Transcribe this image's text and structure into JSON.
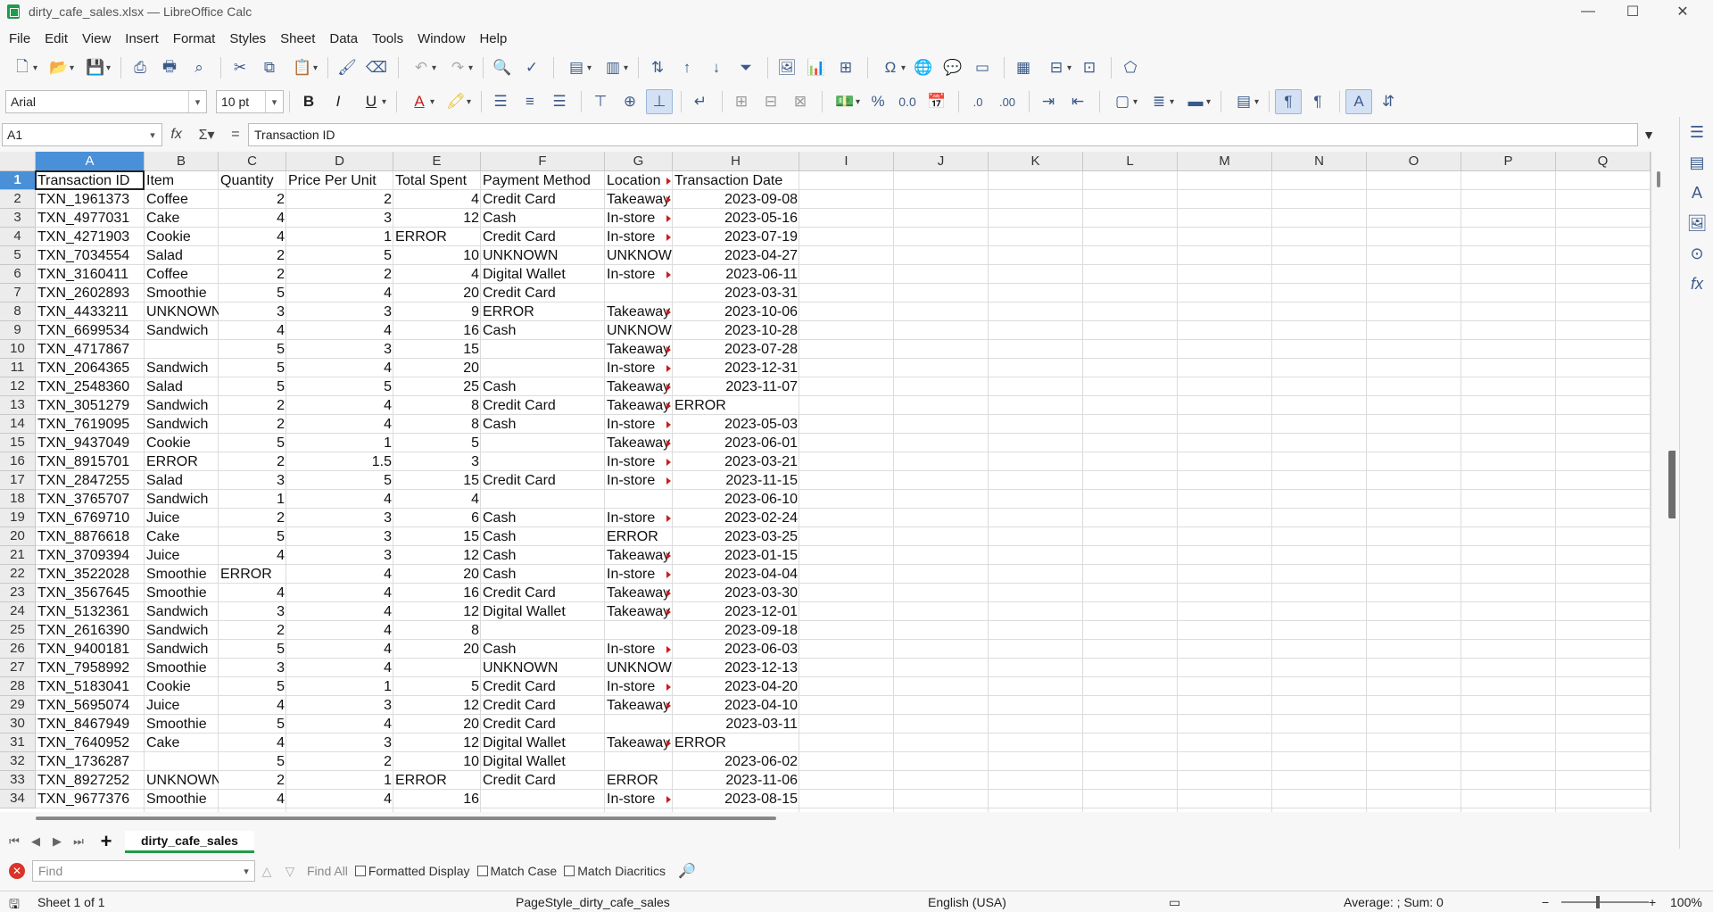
{
  "window": {
    "title": "dirty_cafe_sales.xlsx — LibreOffice Calc",
    "minimize": "—",
    "maximize": "☐",
    "close": "✕"
  },
  "menu": [
    "File",
    "Edit",
    "View",
    "Insert",
    "Format",
    "Styles",
    "Sheet",
    "Data",
    "Tools",
    "Window",
    "Help"
  ],
  "formatting": {
    "font_name": "Arial",
    "font_size": "10 pt"
  },
  "formula_bar": {
    "cell_ref": "A1",
    "content": "Transaction ID"
  },
  "columns": [
    "A",
    "B",
    "C",
    "D",
    "E",
    "F",
    "G",
    "H",
    "I",
    "J",
    "K",
    "L",
    "M",
    "N",
    "O",
    "P",
    "Q"
  ],
  "rows": [
    [
      "Transaction ID",
      "Item",
      "Quantity",
      "Price Per Unit",
      "Total Spent",
      "Payment Method",
      "Location",
      "Transaction Date"
    ],
    [
      "TXN_1961373",
      "Coffee",
      "2",
      "2",
      "4",
      "Credit Card",
      "Takeaway",
      "2023-09-08"
    ],
    [
      "TXN_4977031",
      "Cake",
      "4",
      "3",
      "12",
      "Cash",
      "In-store",
      "2023-05-16"
    ],
    [
      "TXN_4271903",
      "Cookie",
      "4",
      "1",
      "ERROR",
      "Credit Card",
      "In-store",
      "2023-07-19"
    ],
    [
      "TXN_7034554",
      "Salad",
      "2",
      "5",
      "10",
      "UNKNOWN",
      "UNKNOWN",
      "2023-04-27"
    ],
    [
      "TXN_3160411",
      "Coffee",
      "2",
      "2",
      "4",
      "Digital Wallet",
      "In-store",
      "2023-06-11"
    ],
    [
      "TXN_2602893",
      "Smoothie",
      "5",
      "4",
      "20",
      "Credit Card",
      "",
      "2023-03-31"
    ],
    [
      "TXN_4433211",
      "UNKNOWN",
      "3",
      "3",
      "9",
      "ERROR",
      "Takeaway",
      "2023-10-06"
    ],
    [
      "TXN_6699534",
      "Sandwich",
      "4",
      "4",
      "16",
      "Cash",
      "UNKNOWN",
      "2023-10-28"
    ],
    [
      "TXN_4717867",
      "",
      "5",
      "3",
      "15",
      "",
      "Takeaway",
      "2023-07-28"
    ],
    [
      "TXN_2064365",
      "Sandwich",
      "5",
      "4",
      "20",
      "",
      "In-store",
      "2023-12-31"
    ],
    [
      "TXN_2548360",
      "Salad",
      "5",
      "5",
      "25",
      "Cash",
      "Takeaway",
      "2023-11-07"
    ],
    [
      "TXN_3051279",
      "Sandwich",
      "2",
      "4",
      "8",
      "Credit Card",
      "Takeaway",
      "ERROR"
    ],
    [
      "TXN_7619095",
      "Sandwich",
      "2",
      "4",
      "8",
      "Cash",
      "In-store",
      "2023-05-03"
    ],
    [
      "TXN_9437049",
      "Cookie",
      "5",
      "1",
      "5",
      "",
      "Takeaway",
      "2023-06-01"
    ],
    [
      "TXN_8915701",
      "ERROR",
      "2",
      "1.5",
      "3",
      "",
      "In-store",
      "2023-03-21"
    ],
    [
      "TXN_2847255",
      "Salad",
      "3",
      "5",
      "15",
      "Credit Card",
      "In-store",
      "2023-11-15"
    ],
    [
      "TXN_3765707",
      "Sandwich",
      "1",
      "4",
      "4",
      "",
      "",
      "2023-06-10"
    ],
    [
      "TXN_6769710",
      "Juice",
      "2",
      "3",
      "6",
      "Cash",
      "In-store",
      "2023-02-24"
    ],
    [
      "TXN_8876618",
      "Cake",
      "5",
      "3",
      "15",
      "Cash",
      "ERROR",
      "2023-03-25"
    ],
    [
      "TXN_3709394",
      "Juice",
      "4",
      "3",
      "12",
      "Cash",
      "Takeaway",
      "2023-01-15"
    ],
    [
      "TXN_3522028",
      "Smoothie",
      "ERROR",
      "4",
      "20",
      "Cash",
      "In-store",
      "2023-04-04"
    ],
    [
      "TXN_3567645",
      "Smoothie",
      "4",
      "4",
      "16",
      "Credit Card",
      "Takeaway",
      "2023-03-30"
    ],
    [
      "TXN_5132361",
      "Sandwich",
      "3",
      "4",
      "12",
      "Digital Wallet",
      "Takeaway",
      "2023-12-01"
    ],
    [
      "TXN_2616390",
      "Sandwich",
      "2",
      "4",
      "8",
      "",
      "",
      "2023-09-18"
    ],
    [
      "TXN_9400181",
      "Sandwich",
      "5",
      "4",
      "20",
      "Cash",
      "In-store",
      "2023-06-03"
    ],
    [
      "TXN_7958992",
      "Smoothie",
      "3",
      "4",
      "",
      "UNKNOWN",
      "UNKNOWN",
      "2023-12-13"
    ],
    [
      "TXN_5183041",
      "Cookie",
      "5",
      "1",
      "5",
      "Credit Card",
      "In-store",
      "2023-04-20"
    ],
    [
      "TXN_5695074",
      "Juice",
      "4",
      "3",
      "12",
      "Credit Card",
      "Takeaway",
      "2023-04-10"
    ],
    [
      "TXN_8467949",
      "Smoothie",
      "5",
      "4",
      "20",
      "Credit Card",
      "",
      "2023-03-11"
    ],
    [
      "TXN_7640952",
      "Cake",
      "4",
      "3",
      "12",
      "Digital Wallet",
      "Takeaway",
      "ERROR"
    ],
    [
      "TXN_1736287",
      "",
      "5",
      "2",
      "10",
      "Digital Wallet",
      "",
      "2023-06-02"
    ],
    [
      "TXN_8927252",
      "UNKNOWN",
      "2",
      "1",
      "ERROR",
      "Credit Card",
      "ERROR",
      "2023-11-06"
    ],
    [
      "TXN_9677376",
      "Smoothie",
      "4",
      "4",
      "16",
      "",
      "In-store",
      "2023-08-15"
    ]
  ],
  "sheet_tab": "dirty_cafe_sales",
  "find_bar": {
    "placeholder": "Find",
    "find_all": "Find All",
    "formatted_display": "Formatted Display",
    "match_case": "Match Case",
    "match_diacritics": "Match Diacritics"
  },
  "status": {
    "sheet": "Sheet 1 of 1",
    "page_style": "PageStyle_dirty_cafe_sales",
    "language": "English (USA)",
    "summary": "Average: ; Sum: 0",
    "zoom": "100%"
  },
  "colors": {
    "selection": "#4a90d9",
    "accent": "#1e9c4a",
    "overflow_marker": "#c81e1e"
  }
}
